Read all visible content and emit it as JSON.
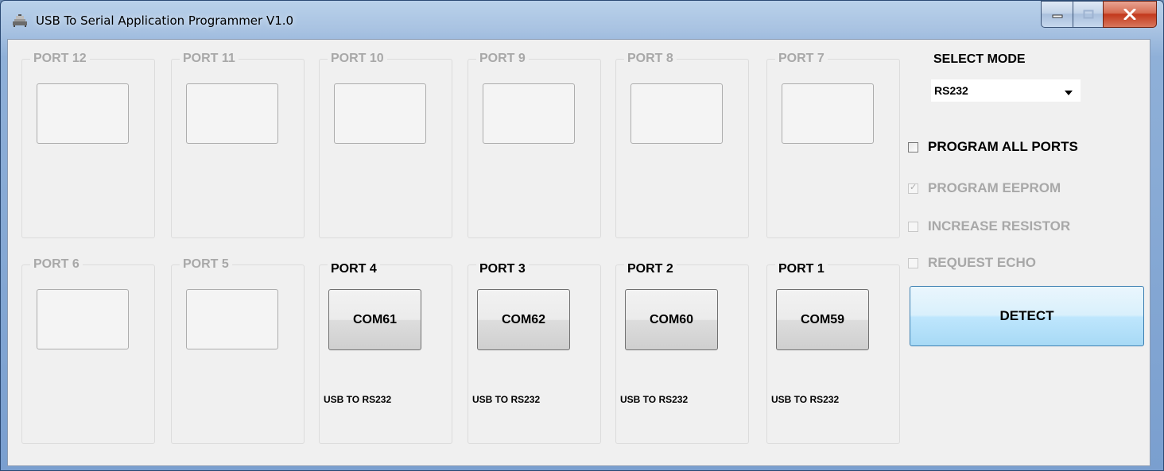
{
  "window": {
    "title": "USB To Serial Application Programmer V1.0"
  },
  "ports_top": [
    {
      "label": "PORT 12"
    },
    {
      "label": "PORT 11"
    },
    {
      "label": "PORT 10"
    },
    {
      "label": "PORT 9"
    },
    {
      "label": "PORT 8"
    },
    {
      "label": "PORT 7"
    }
  ],
  "ports_bottom": [
    {
      "label": "PORT 6"
    },
    {
      "label": "PORT 5"
    },
    {
      "label": "PORT 4",
      "com": "COM61",
      "type": "USB TO RS232"
    },
    {
      "label": "PORT 3",
      "com": "COM62",
      "type": "USB TO RS232"
    },
    {
      "label": "PORT 2",
      "com": "COM60",
      "type": "USB TO RS232"
    },
    {
      "label": "PORT 1",
      "com": "COM59",
      "type": "USB TO RS232"
    }
  ],
  "settings": {
    "mode_label": "SELECT MODE",
    "mode_value": "RS232",
    "program_all_ports": {
      "label": "PROGRAM ALL PORTS",
      "checked": false,
      "enabled": true
    },
    "program_eeprom": {
      "label": "PROGRAM EEPROM",
      "checked": true,
      "enabled": false
    },
    "increase_resistor": {
      "label": "INCREASE RESISTOR",
      "checked": false,
      "enabled": false
    },
    "request_echo": {
      "label": "REQUEST ECHO",
      "checked": false,
      "enabled": false
    },
    "detect_label": "DETECT"
  },
  "colors": {
    "detect_button": "#bee6fd",
    "disabled_text": "#a8a8a8"
  }
}
